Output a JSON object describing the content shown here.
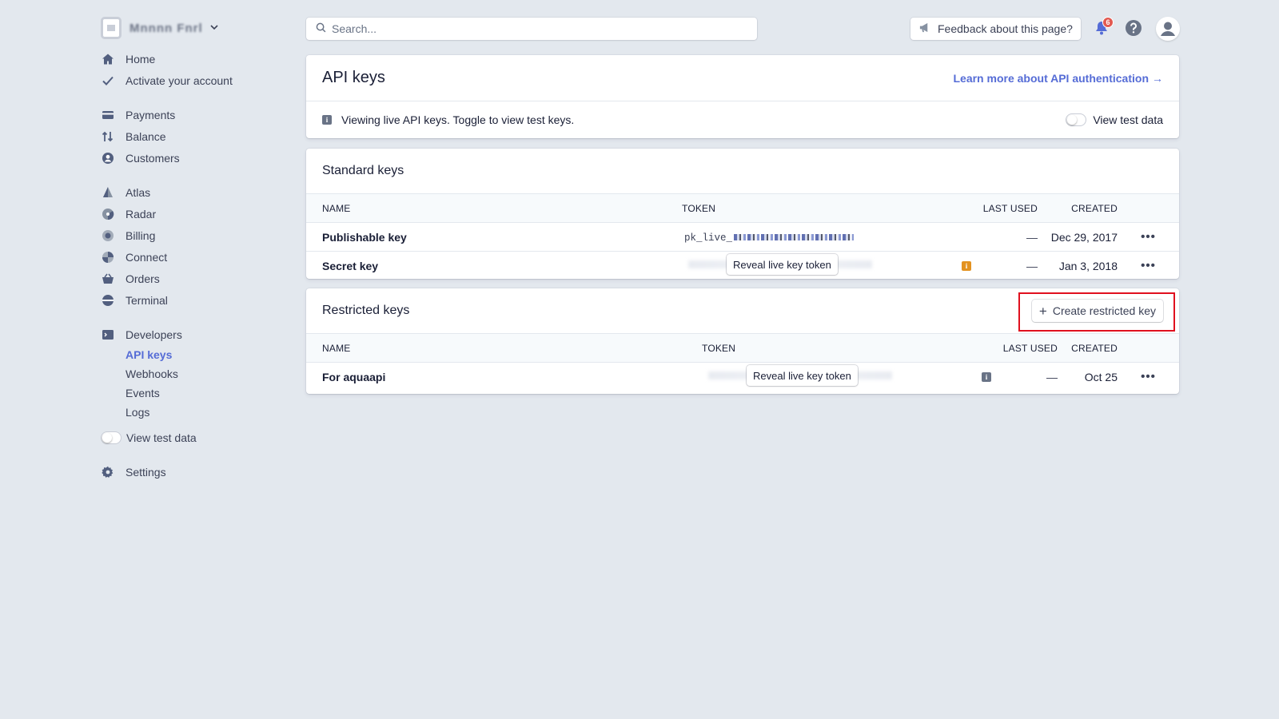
{
  "sidebar": {
    "account_name": "Mnnnn Fnrl",
    "group1": [
      {
        "label": "Home",
        "icon": "home-icon"
      },
      {
        "label": "Activate your account",
        "icon": "checkmark-icon"
      }
    ],
    "group2": [
      {
        "label": "Payments",
        "icon": "payments-icon"
      },
      {
        "label": "Balance",
        "icon": "balance-icon"
      },
      {
        "label": "Customers",
        "icon": "customers-icon"
      }
    ],
    "group3": [
      {
        "label": "Atlas",
        "icon": "atlas-icon"
      },
      {
        "label": "Radar",
        "icon": "radar-icon"
      },
      {
        "label": "Billing",
        "icon": "billing-icon"
      },
      {
        "label": "Connect",
        "icon": "connect-icon"
      },
      {
        "label": "Orders",
        "icon": "orders-icon"
      },
      {
        "label": "Terminal",
        "icon": "terminal-icon"
      }
    ],
    "developers": {
      "label": "Developers",
      "icon": "developers-icon",
      "sub": [
        {
          "label": "API keys",
          "active": true
        },
        {
          "label": "Webhooks"
        },
        {
          "label": "Events"
        },
        {
          "label": "Logs"
        }
      ]
    },
    "view_test_data": "View test data",
    "settings": {
      "label": "Settings",
      "icon": "gear-icon"
    }
  },
  "topbar": {
    "search_placeholder": "Search...",
    "feedback_label": "Feedback about this page?",
    "notification_count": "6"
  },
  "api_keys": {
    "title": "API keys",
    "learn_more": "Learn more about API authentication",
    "learn_arrow": "→",
    "info_text": "Viewing live API keys. Toggle to view test keys.",
    "view_test_data": "View test data"
  },
  "standard_keys": {
    "title": "Standard keys",
    "columns": [
      "NAME",
      "TOKEN",
      "LAST USED",
      "CREATED"
    ],
    "rows": [
      {
        "name": "Publishable key",
        "token_prefix": "pk_live_",
        "last_used": "—",
        "created": "Dec 29, 2017",
        "more": "•••"
      },
      {
        "name": "Secret key",
        "reveal_label": "Reveal live key token",
        "last_used": "—",
        "created": "Jan 3, 2018",
        "more": "•••"
      }
    ]
  },
  "restricted_keys": {
    "title": "Restricted keys",
    "create_label": "Create restricted key",
    "create_icon": "+",
    "columns": [
      "NAME",
      "TOKEN",
      "LAST USED",
      "CREATED"
    ],
    "rows": [
      {
        "name": "For aquaapi",
        "reveal_label": "Reveal live key token",
        "last_used": "—",
        "created": "Oct 25",
        "more": "•••"
      }
    ]
  },
  "colors": {
    "accent": "#556cd6",
    "background": "#e3e8ee",
    "highlight": "#e0101e",
    "badge": "#e25950",
    "warning": "#e39220"
  }
}
